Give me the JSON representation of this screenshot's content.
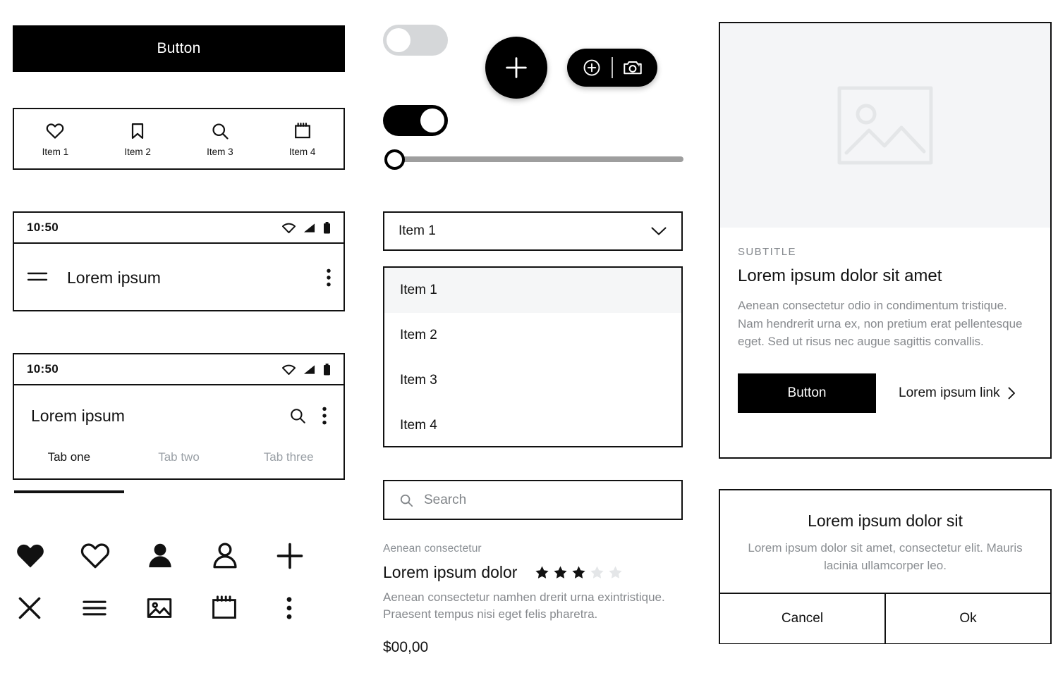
{
  "left_column": {
    "primary_button": {
      "label": "Button"
    },
    "bottom_nav": {
      "items": [
        {
          "label": "Item 1",
          "icon": "heart-outline-icon"
        },
        {
          "label": "Item 2",
          "icon": "bookmark-icon"
        },
        {
          "label": "Item 3",
          "icon": "search-icon"
        },
        {
          "label": "Item 4",
          "icon": "calendar-icon"
        }
      ]
    },
    "appbar_simple": {
      "status_bar": {
        "time": "10:50",
        "icons": [
          "wifi-icon",
          "signal-icon",
          "battery-icon"
        ]
      },
      "menu_icon": "hamburger-menu-icon",
      "title": "Lorem ipsum",
      "overflow_icon": "kebab-menu-icon"
    },
    "appbar_tabs": {
      "status_bar": {
        "time": "10:50",
        "icons": [
          "wifi-icon",
          "signal-icon",
          "battery-icon"
        ]
      },
      "title": "Lorem ipsum",
      "actions": [
        "search-icon",
        "kebab-menu-icon"
      ],
      "tabs": [
        {
          "label": "Tab one",
          "active": true
        },
        {
          "label": "Tab two",
          "active": false
        },
        {
          "label": "Tab three",
          "active": false
        }
      ]
    },
    "icon_grid": {
      "row1": [
        "heart-filled-icon",
        "heart-outline-icon",
        "person-filled-icon",
        "person-outline-icon",
        "plus-icon"
      ],
      "row2": [
        "close-icon",
        "hamburger-menu-icon",
        "image-icon",
        "calendar-icon",
        "kebab-menu-icon"
      ]
    }
  },
  "middle_column": {
    "switch_off": {
      "state": "off",
      "name": "toggle-switch-off"
    },
    "switch_on": {
      "state": "on",
      "name": "toggle-switch-on"
    },
    "fab": {
      "icon": "plus-icon"
    },
    "fab_extended": {
      "icons": [
        "plus-circle-icon",
        "camera-icon"
      ]
    },
    "slider": {
      "value": 0,
      "min": 0,
      "max": 100
    },
    "select": {
      "value": "Item 1",
      "chevron": "chevron-down-icon"
    },
    "list": {
      "items": [
        {
          "label": "Item 1",
          "selected": true
        },
        {
          "label": "Item 2",
          "selected": false
        },
        {
          "label": "Item 3",
          "selected": false
        },
        {
          "label": "Item 4",
          "selected": false
        }
      ]
    },
    "search": {
      "value": "",
      "placeholder": "Search",
      "icon": "search-icon"
    },
    "product": {
      "eyebrow": "Aenean consectetur",
      "title": "Lorem ipsum dolor",
      "rating": {
        "filled": 3,
        "total": 5
      },
      "description": "Aenean consectetur namhen drerit urna exintristique. Praesent tempus nisi eget felis pharetra.",
      "price": "$00,00"
    }
  },
  "right_column": {
    "card": {
      "media_icon": "image-placeholder-icon",
      "subtitle": "SUBTITLE",
      "headline": "Lorem ipsum dolor sit amet",
      "paragraph": "Aenean consectetur odio in condimentum tristique. Nam hendrerit urna ex, non pretium erat pellentesque eget. Sed ut risus nec augue sagittis convallis.",
      "button_label": "Button",
      "link_label": "Lorem ipsum link",
      "link_icon": "chevron-right-icon"
    },
    "dialog": {
      "title": "Lorem ipsum dolor sit",
      "text": "Lorem ipsum dolor sit amet, consectetur elit. Mauris lacinia ullamcorper leo.",
      "cancel_label": "Cancel",
      "ok_label": "Ok"
    }
  },
  "colors": {
    "black": "#000000",
    "text": "#111111",
    "muted": "#86898d",
    "border": "#111111",
    "track": "#9e9e9e",
    "switch_off": "#d5d7d9",
    "media_bg": "#f4f5f7",
    "selected_row": "#f5f6f7",
    "star_empty": "#e4e6e8"
  }
}
